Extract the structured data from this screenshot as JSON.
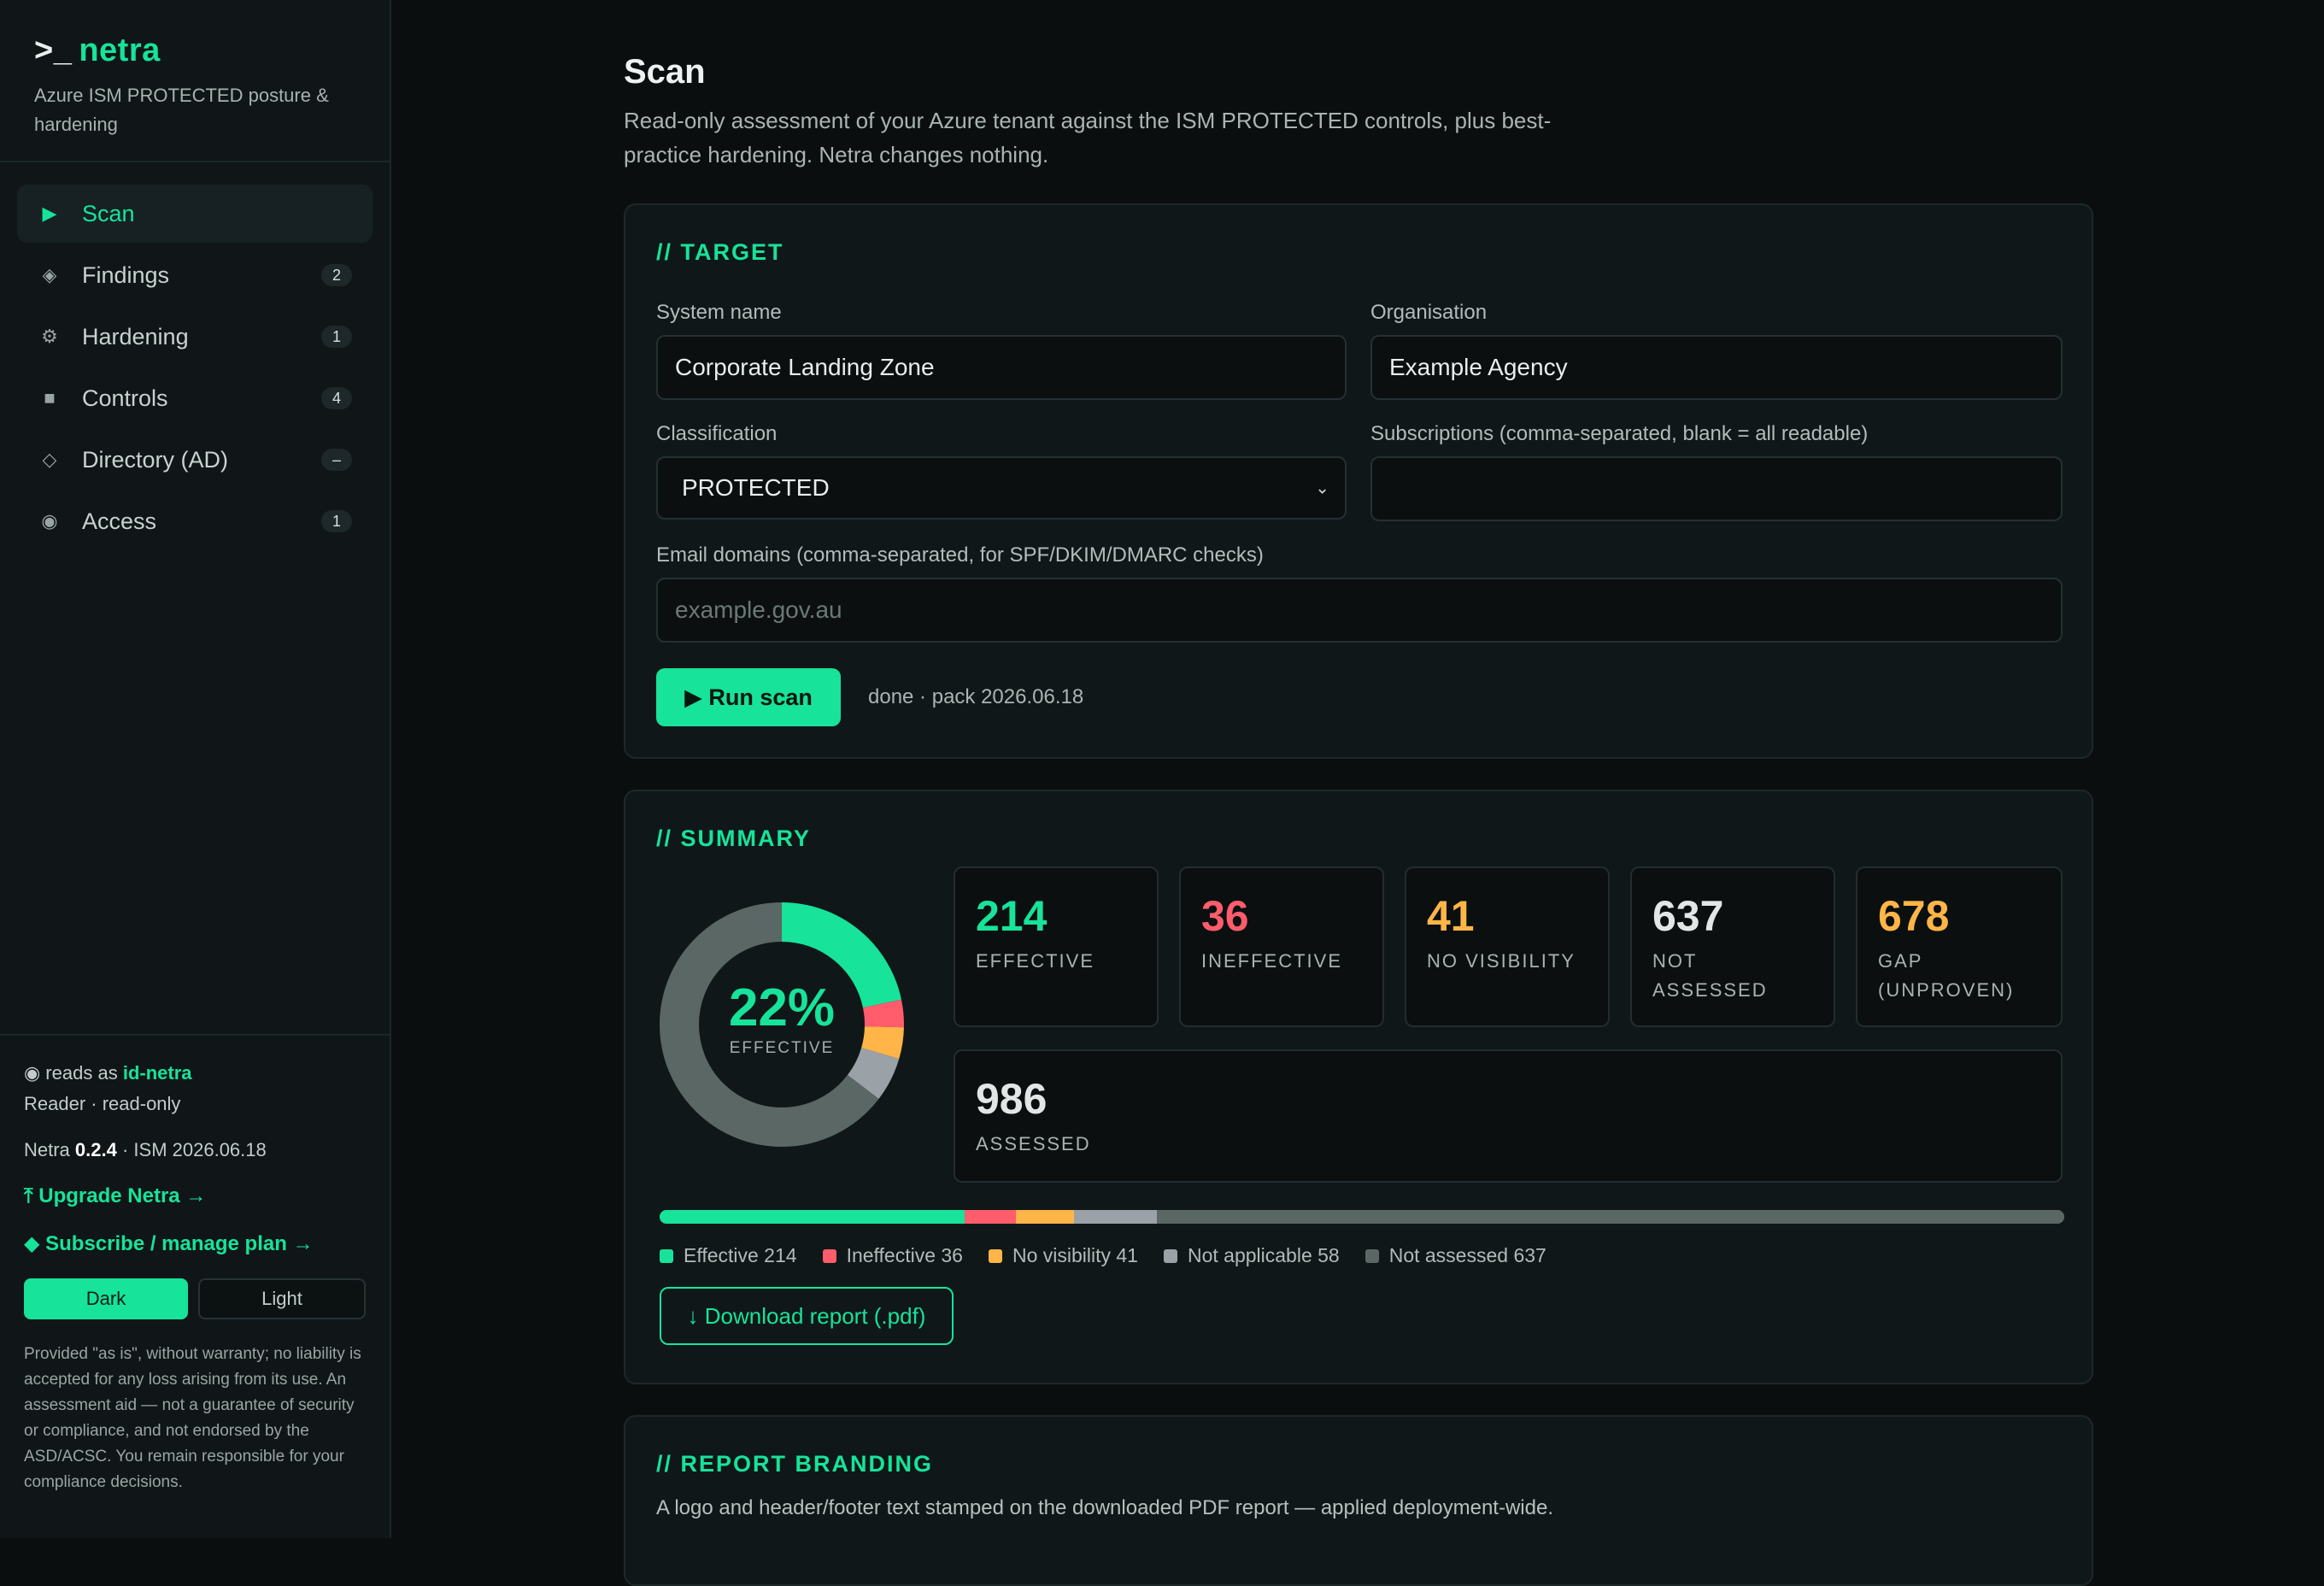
{
  "brand": {
    "prompt": ">_",
    "name": "netra",
    "subtitle": "Azure ISM PROTECTED posture & hardening"
  },
  "nav": [
    {
      "icon": "▶",
      "label": "Scan",
      "badge": ""
    },
    {
      "icon": "◈",
      "label": "Findings",
      "badge": "2"
    },
    {
      "icon": "⚙",
      "label": "Hardening",
      "badge": "1"
    },
    {
      "icon": "■",
      "label": "Controls",
      "badge": "4"
    },
    {
      "icon": "◇",
      "label": "Directory (AD)",
      "badge": "–"
    },
    {
      "icon": "◉",
      "label": "Access",
      "badge": "1"
    }
  ],
  "sidebar_footer": {
    "reads_as_prefix": "◉ reads as",
    "identity": "id-netra",
    "role": "Reader · read-only",
    "version_prefix": "Netra",
    "version": "0.2.4",
    "ism": "· ISM 2026.06.18",
    "upgrade_link": "⤒ Upgrade Netra →",
    "subscribe_link": "◆ Subscribe / manage plan →",
    "theme_dark": "Dark",
    "theme_light": "Light",
    "disclaimer": "Provided \"as is\", without warranty; no liability is accepted for any loss arising from its use. An assessment aid — not a guarantee of security or compliance, and not endorsed by the ASD/ACSC. You remain responsible for your compliance decisions."
  },
  "page": {
    "title": "Scan",
    "description": "Read-only assessment of your Azure tenant against the ISM PROTECTED controls, plus best-practice hardening. Netra changes nothing."
  },
  "target": {
    "heading": "// TARGET",
    "system_name_label": "System name",
    "system_name_value": "Corporate Landing Zone",
    "organisation_label": "Organisation",
    "organisation_value": "Example Agency",
    "classification_label": "Classification",
    "classification_value": "PROTECTED",
    "subscriptions_label": "Subscriptions (comma-separated, blank = all readable)",
    "subscriptions_value": "",
    "email_domains_label": "Email domains (comma-separated, for SPF/DKIM/DMARC checks)",
    "email_domains_placeholder": "example.gov.au",
    "run_button": "▶ Run scan",
    "status": "done · pack 2026.06.18"
  },
  "summary": {
    "heading": "// SUMMARY",
    "donut_pct": "22%",
    "donut_label": "EFFECTIVE",
    "stats": [
      {
        "value": "214",
        "label": "EFFECTIVE",
        "color": "#17e39a"
      },
      {
        "value": "36",
        "label": "INEFFECTIVE",
        "color": "#ff5c6c"
      },
      {
        "value": "41",
        "label": "NO VISIBILITY",
        "color": "#ffb547"
      },
      {
        "value": "637",
        "label": "NOT ASSESSED",
        "color": "#e2e7e6"
      },
      {
        "value": "678",
        "label": "GAP (UNPROVEN)",
        "color": "#ffb547"
      },
      {
        "value": "986",
        "label": "ASSESSED",
        "color": "#e2e7e6"
      }
    ],
    "breakdown": [
      {
        "label": "Effective 214",
        "value": 214,
        "color": "#17e39a"
      },
      {
        "label": "Ineffective 36",
        "value": 36,
        "color": "#ff5c6c"
      },
      {
        "label": "No visibility 41",
        "value": 41,
        "color": "#ffb547"
      },
      {
        "label": "Not applicable 58",
        "value": 58,
        "color": "#9aa2a8"
      },
      {
        "label": "Not assessed 637",
        "value": 637,
        "color": "#5a6764"
      }
    ],
    "download_button": "↓ Download report (.pdf)"
  },
  "branding": {
    "heading": "// REPORT BRANDING",
    "description": "A logo and header/footer text stamped on the downloaded PDF report — applied deployment-wide."
  }
}
